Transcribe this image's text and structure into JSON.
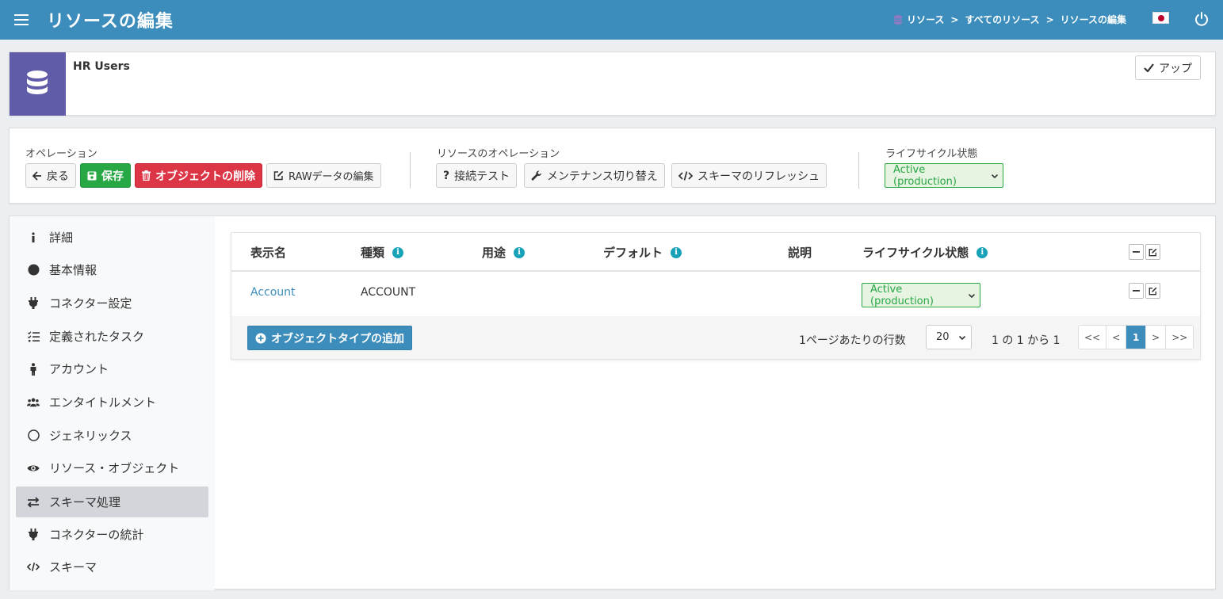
{
  "header": {
    "title": "リソースの編集",
    "breadcrumb": [
      "リソース",
      "すべてのリソース",
      "リソースの編集"
    ],
    "breadcrumb_sep": ">"
  },
  "object": {
    "name": "HR Users",
    "up_button": "アップ"
  },
  "operations": {
    "ops_label": "オペレーション",
    "back": "戻る",
    "save": "保存",
    "delete": "オブジェクトの削除",
    "edit_raw": "RAWデータの編集",
    "resource_ops_label": "リソースのオペレーション",
    "test_connection": "接続テスト",
    "toggle_maintenance": "メンテナンス切り替え",
    "refresh_schema": "スキーマのリフレッシュ",
    "lifecycle_label": "ライフサイクル状態",
    "lifecycle_value": "Active (production)"
  },
  "sidebar": {
    "items": [
      {
        "label": "詳細",
        "icon": "info-icon"
      },
      {
        "label": "基本情報",
        "icon": "circle-icon"
      },
      {
        "label": "コネクター設定",
        "icon": "plug-icon"
      },
      {
        "label": "定義されたタスク",
        "icon": "tasks-icon"
      },
      {
        "label": "アカウント",
        "icon": "person-icon"
      },
      {
        "label": "エンタイトルメント",
        "icon": "users-icon"
      },
      {
        "label": "ジェネリックス",
        "icon": "circle-outline-icon"
      },
      {
        "label": "リソース・オブジェクト",
        "icon": "eye-icon"
      },
      {
        "label": "スキーマ処理",
        "icon": "exchange-icon"
      },
      {
        "label": "コネクターの統計",
        "icon": "plug-icon"
      },
      {
        "label": "スキーマ",
        "icon": "code-icon"
      }
    ],
    "active_index": 8
  },
  "table": {
    "columns": [
      "表示名",
      "種類",
      "用途",
      "デフォルト",
      "説明",
      "ライフサイクル状態"
    ],
    "rows": [
      {
        "display_name": "Account",
        "kind": "ACCOUNT",
        "intent": "",
        "default": "",
        "description": "",
        "lifecycle": "Active (production)"
      }
    ],
    "add_button": "オブジェクトタイプの追加",
    "rows_per_page_label": "1ページあたりの行数",
    "rows_per_page": "20",
    "range_text": "1 の 1 から 1",
    "pager": [
      "<<",
      "<",
      "1",
      ">",
      ">>"
    ]
  },
  "colors": {
    "header": "#3c8dbc",
    "object_icon_bg": "#605ca8",
    "success": "#28a745",
    "danger": "#dc3545",
    "info": "#17a2b8"
  }
}
